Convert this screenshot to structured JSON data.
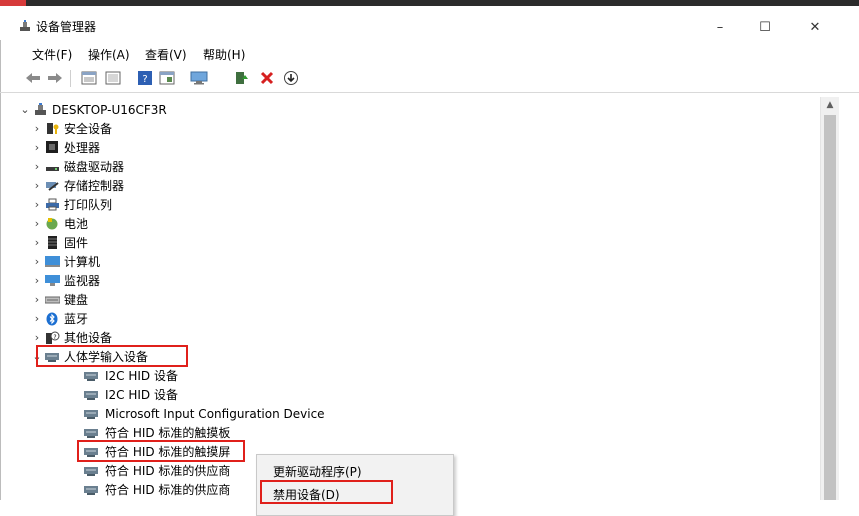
{
  "window": {
    "title": "设备管理器",
    "controls": {
      "minimize": "–",
      "maximize": "☐",
      "close": "✕"
    }
  },
  "menu": [
    "文件(F)",
    "操作(A)",
    "查看(V)",
    "帮助(H)"
  ],
  "toolbar": {
    "icons": [
      "back-arrow-icon",
      "forward-arrow-icon",
      "properties-icon",
      "view-icon",
      "help-icon",
      "panel-icon",
      "monitor-icon",
      "update-driver-icon",
      "uninstall-icon",
      "scan-icon"
    ]
  },
  "tree": {
    "root": "DESKTOP-U16CF3R",
    "categories": [
      {
        "label": "安全设备",
        "icon": "security-device-icon"
      },
      {
        "label": "处理器",
        "icon": "processor-icon"
      },
      {
        "label": "磁盘驱动器",
        "icon": "disk-drive-icon"
      },
      {
        "label": "存储控制器",
        "icon": "storage-controller-icon"
      },
      {
        "label": "打印队列",
        "icon": "print-queue-icon"
      },
      {
        "label": "电池",
        "icon": "battery-icon"
      },
      {
        "label": "固件",
        "icon": "firmware-icon"
      },
      {
        "label": "计算机",
        "icon": "computer-icon"
      },
      {
        "label": "监视器",
        "icon": "monitor-icon"
      },
      {
        "label": "键盘",
        "icon": "keyboard-icon"
      },
      {
        "label": "蓝牙",
        "icon": "bluetooth-icon"
      },
      {
        "label": "其他设备",
        "icon": "other-devices-icon"
      },
      {
        "label": "人体学输入设备",
        "icon": "hid-icon",
        "expanded": true
      }
    ],
    "hid_children": [
      "I2C HID 设备",
      "I2C HID 设备",
      "Microsoft Input Configuration Device",
      "符合 HID 标准的触摸板",
      "符合 HID 标准的触摸屏",
      "符合 HID 标准的供应商",
      "符合 HID 标准的供应商"
    ]
  },
  "context_menu": {
    "items": [
      "更新驱动程序(P)",
      "禁用设备(D)"
    ]
  },
  "colors": {
    "highlight_box": "#e0201b",
    "scrollbar_thumb": "#c2c2c2"
  }
}
